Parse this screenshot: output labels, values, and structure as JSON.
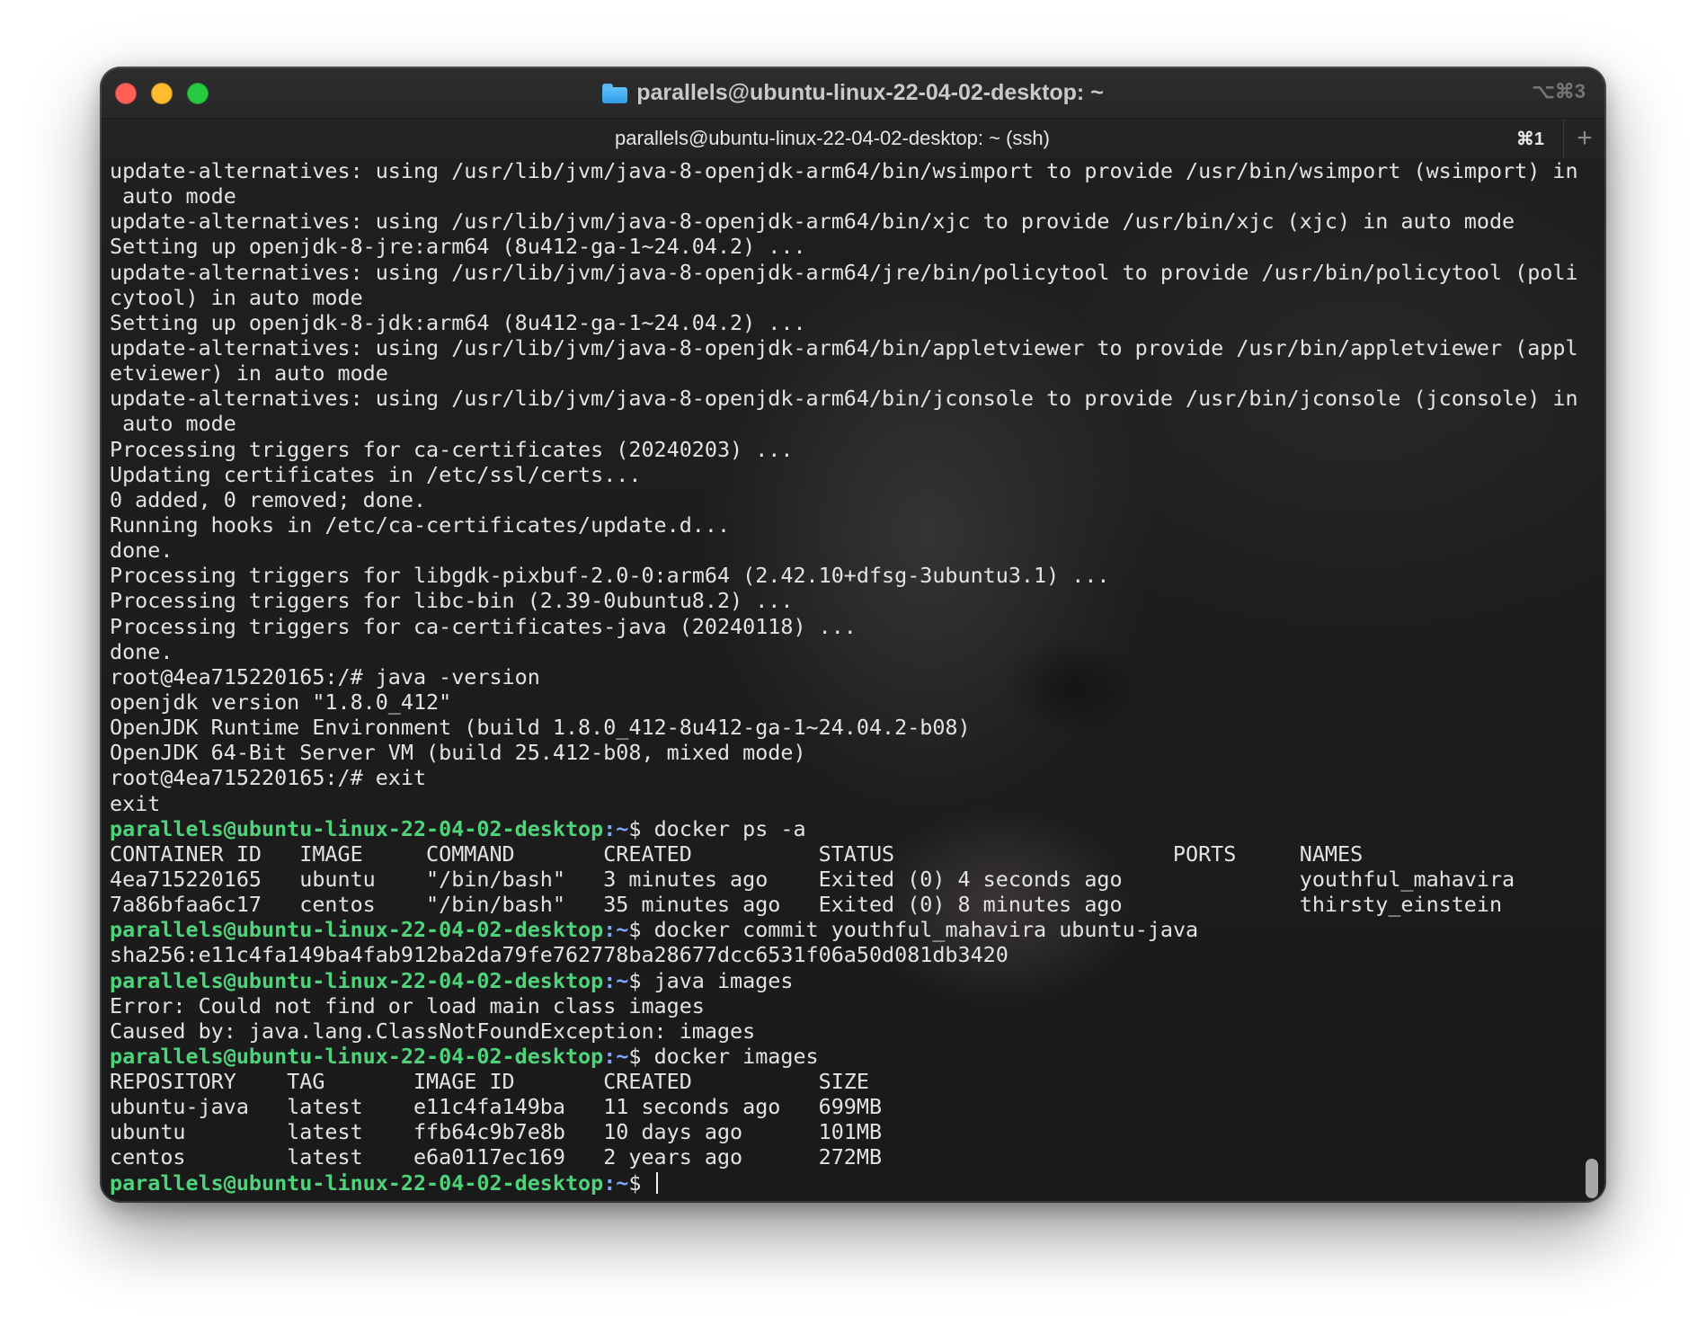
{
  "window": {
    "title": "parallels@ubuntu-linux-22-04-02-desktop: ~",
    "shortcut": "⌥⌘3"
  },
  "tab": {
    "title": "parallels@ubuntu-linux-22-04-02-desktop: ~ (ssh)",
    "shortcut": "⌘1",
    "new_tab_label": "+"
  },
  "prompt": {
    "user_host": "parallels@ubuntu-linux-22-04-02-desktop",
    "path": ":~",
    "symbol": "$ "
  },
  "terminal": {
    "lines": [
      {
        "type": "output",
        "text": "update-alternatives: using /usr/lib/jvm/java-8-openjdk-arm64/bin/wsimport to provide /usr/bin/wsimport (wsimport) in"
      },
      {
        "type": "output",
        "text": " auto mode"
      },
      {
        "type": "output",
        "text": "update-alternatives: using /usr/lib/jvm/java-8-openjdk-arm64/bin/xjc to provide /usr/bin/xjc (xjc) in auto mode"
      },
      {
        "type": "output",
        "text": "Setting up openjdk-8-jre:arm64 (8u412-ga-1~24.04.2) ..."
      },
      {
        "type": "output",
        "text": "update-alternatives: using /usr/lib/jvm/java-8-openjdk-arm64/jre/bin/policytool to provide /usr/bin/policytool (poli"
      },
      {
        "type": "output",
        "text": "cytool) in auto mode"
      },
      {
        "type": "output",
        "text": "Setting up openjdk-8-jdk:arm64 (8u412-ga-1~24.04.2) ..."
      },
      {
        "type": "output",
        "text": "update-alternatives: using /usr/lib/jvm/java-8-openjdk-arm64/bin/appletviewer to provide /usr/bin/appletviewer (appl"
      },
      {
        "type": "output",
        "text": "etviewer) in auto mode"
      },
      {
        "type": "output",
        "text": "update-alternatives: using /usr/lib/jvm/java-8-openjdk-arm64/bin/jconsole to provide /usr/bin/jconsole (jconsole) in"
      },
      {
        "type": "output",
        "text": " auto mode"
      },
      {
        "type": "output",
        "text": "Processing triggers for ca-certificates (20240203) ..."
      },
      {
        "type": "output",
        "text": "Updating certificates in /etc/ssl/certs..."
      },
      {
        "type": "output",
        "text": "0 added, 0 removed; done."
      },
      {
        "type": "output",
        "text": "Running hooks in /etc/ca-certificates/update.d..."
      },
      {
        "type": "output",
        "text": "done."
      },
      {
        "type": "output",
        "text": "Processing triggers for libgdk-pixbuf-2.0-0:arm64 (2.42.10+dfsg-3ubuntu3.1) ..."
      },
      {
        "type": "output",
        "text": "Processing triggers for libc-bin (2.39-0ubuntu8.2) ..."
      },
      {
        "type": "output",
        "text": "Processing triggers for ca-certificates-java (20240118) ..."
      },
      {
        "type": "output",
        "text": "done."
      },
      {
        "type": "output",
        "text": "root@4ea715220165:/# java -version"
      },
      {
        "type": "output",
        "text": "openjdk version \"1.8.0_412\""
      },
      {
        "type": "output",
        "text": "OpenJDK Runtime Environment (build 1.8.0_412-8u412-ga-1~24.04.2-b08)"
      },
      {
        "type": "output",
        "text": "OpenJDK 64-Bit Server VM (build 25.412-b08, mixed mode)"
      },
      {
        "type": "output",
        "text": "root@4ea715220165:/# exit"
      },
      {
        "type": "output",
        "text": "exit"
      },
      {
        "type": "prompt",
        "text": "docker ps -a"
      },
      {
        "type": "output",
        "text": "CONTAINER ID   IMAGE     COMMAND       CREATED          STATUS                      PORTS     NAMES"
      },
      {
        "type": "output",
        "text": "4ea715220165   ubuntu    \"/bin/bash\"   3 minutes ago    Exited (0) 4 seconds ago              youthful_mahavira"
      },
      {
        "type": "output",
        "text": "7a86bfaa6c17   centos    \"/bin/bash\"   35 minutes ago   Exited (0) 8 minutes ago              thirsty_einstein"
      },
      {
        "type": "prompt",
        "text": "docker commit youthful_mahavira ubuntu-java"
      },
      {
        "type": "output",
        "text": "sha256:e11c4fa149ba4fab912ba2da79fe762778ba28677dcc6531f06a50d081db3420"
      },
      {
        "type": "prompt",
        "text": "java images"
      },
      {
        "type": "output",
        "text": "Error: Could not find or load main class images"
      },
      {
        "type": "output",
        "text": "Caused by: java.lang.ClassNotFoundException: images"
      },
      {
        "type": "prompt",
        "text": "docker images"
      },
      {
        "type": "output",
        "text": "REPOSITORY    TAG       IMAGE ID       CREATED          SIZE"
      },
      {
        "type": "output",
        "text": "ubuntu-java   latest    e11c4fa149ba   11 seconds ago   699MB"
      },
      {
        "type": "output",
        "text": "ubuntu        latest    ffb64c9b7e8b   10 days ago      101MB"
      },
      {
        "type": "output",
        "text": "centos        latest    e6a0117ec169   2 years ago      272MB"
      },
      {
        "type": "prompt",
        "text": "",
        "cursor": true
      }
    ]
  },
  "colors": {
    "prompt_user": "#4fd37a",
    "prompt_path": "#7ca8ff",
    "output_text": "#e3e3e3",
    "close": "#ff5f57",
    "minimize": "#febc2e",
    "maximize": "#28c840"
  }
}
